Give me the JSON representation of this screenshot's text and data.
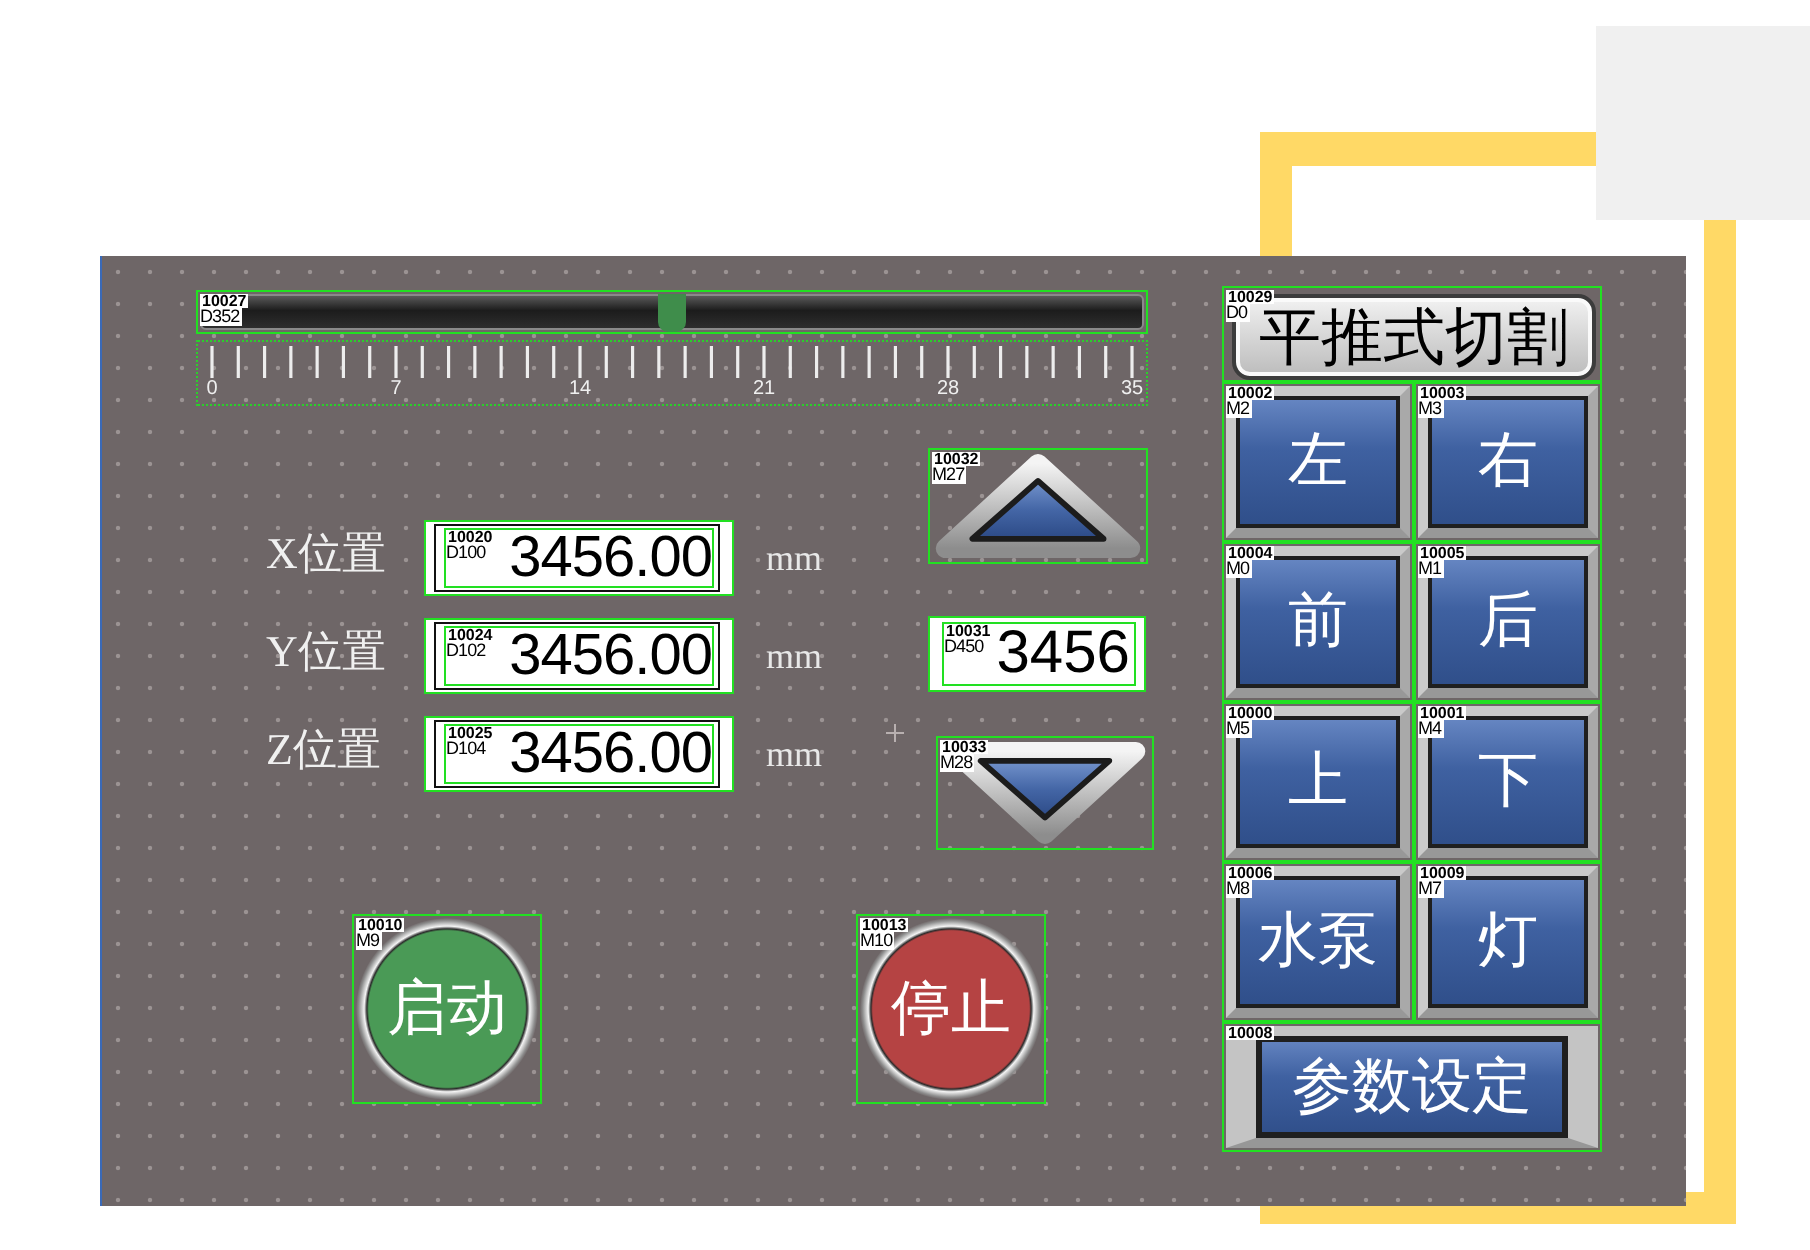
{
  "slider": {
    "tags": [
      "10027",
      "D352"
    ],
    "level": 0.5,
    "scale": [
      "0",
      "7",
      "14",
      "21",
      "28",
      "35"
    ]
  },
  "positions": [
    {
      "label": "X位置",
      "tags": [
        "10020",
        "D100"
      ],
      "value": "3456.00",
      "unit": "mm"
    },
    {
      "label": "Y位置",
      "tags": [
        "10024",
        "D102"
      ],
      "value": "3456.00",
      "unit": "mm"
    },
    {
      "label": "Z位置",
      "tags": [
        "10025",
        "D104"
      ],
      "value": "3456.00",
      "unit": "mm"
    }
  ],
  "jog": [
    {
      "kind": "up",
      "tags": [
        "10032",
        "M27"
      ]
    },
    {
      "kind": "numeric",
      "tags": [
        "10031",
        "D450"
      ],
      "value": "3456"
    },
    {
      "kind": "down",
      "tags": [
        "10033",
        "M28"
      ]
    }
  ],
  "round_buttons": [
    {
      "label": "启动",
      "tags": [
        "10010",
        "M9"
      ],
      "color": "#4a9a56"
    },
    {
      "label": "停止",
      "tags": [
        "10013",
        "M10"
      ],
      "color": "#b54343"
    }
  ],
  "mode_button": {
    "label": "平推式切割",
    "tags": [
      "10029",
      "D0"
    ]
  },
  "grid_buttons": [
    {
      "label": "左",
      "tags": [
        "10002",
        "M2"
      ]
    },
    {
      "label": "右",
      "tags": [
        "10003",
        "M3"
      ]
    },
    {
      "label": "前",
      "tags": [
        "10004",
        "M0"
      ]
    },
    {
      "label": "后",
      "tags": [
        "10005",
        "M1"
      ]
    },
    {
      "label": "上",
      "tags": [
        "10000",
        "M5"
      ]
    },
    {
      "label": "下",
      "tags": [
        "10001",
        "M4"
      ]
    },
    {
      "label": "水泵",
      "tags": [
        "10006",
        "M8"
      ]
    },
    {
      "label": "灯",
      "tags": [
        "10009",
        "M7"
      ]
    }
  ],
  "settings_button": {
    "label": "参数设定",
    "tags": [
      "10008"
    ]
  }
}
